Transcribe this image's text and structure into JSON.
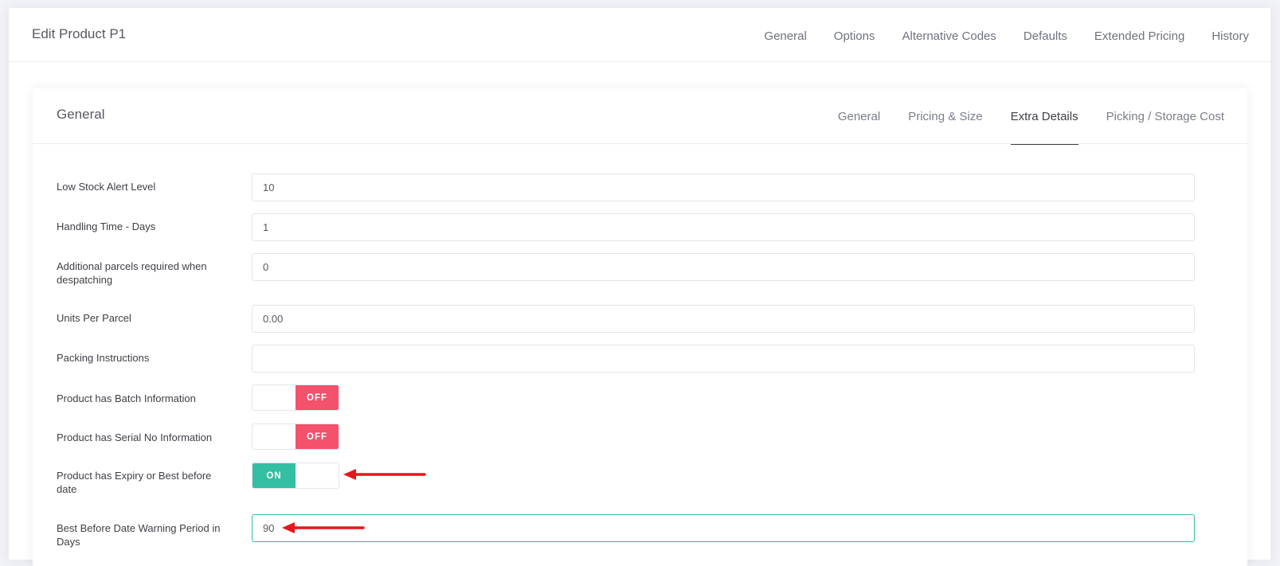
{
  "page": {
    "title": "Edit Product P1",
    "tabs": [
      "General",
      "Options",
      "Alternative Codes",
      "Defaults",
      "Extended Pricing",
      "History"
    ]
  },
  "section": {
    "title": "General",
    "tabs": [
      "General",
      "Pricing & Size",
      "Extra Details",
      "Picking / Storage Cost"
    ],
    "active_tab": "Extra Details"
  },
  "fields": {
    "low_stock": {
      "label": "Low Stock Alert Level",
      "value": "10"
    },
    "handling_time": {
      "label": "Handling Time - Days",
      "value": "1"
    },
    "additional_parcels": {
      "label": "Additional parcels required when despatching",
      "value": "0"
    },
    "units_per_parcel": {
      "label": "Units Per Parcel",
      "value": "0.00"
    },
    "packing_instructions": {
      "label": "Packing Instructions",
      "value": ""
    },
    "batch_info": {
      "label": "Product has Batch Information",
      "state": "OFF"
    },
    "serial_info": {
      "label": "Product has Serial No Information",
      "state": "OFF"
    },
    "expiry_info": {
      "label": "Product has Expiry or Best before date",
      "state": "ON"
    },
    "best_before_warning": {
      "label": "Best Before Date Warning Period in Days",
      "value": "90"
    }
  },
  "colors": {
    "toggle_off": "#f4516c",
    "toggle_on": "#34bfa3",
    "annotation_arrow": "#e8161b"
  },
  "icons": {
    "annotation": "red-arrow-left-icon"
  }
}
